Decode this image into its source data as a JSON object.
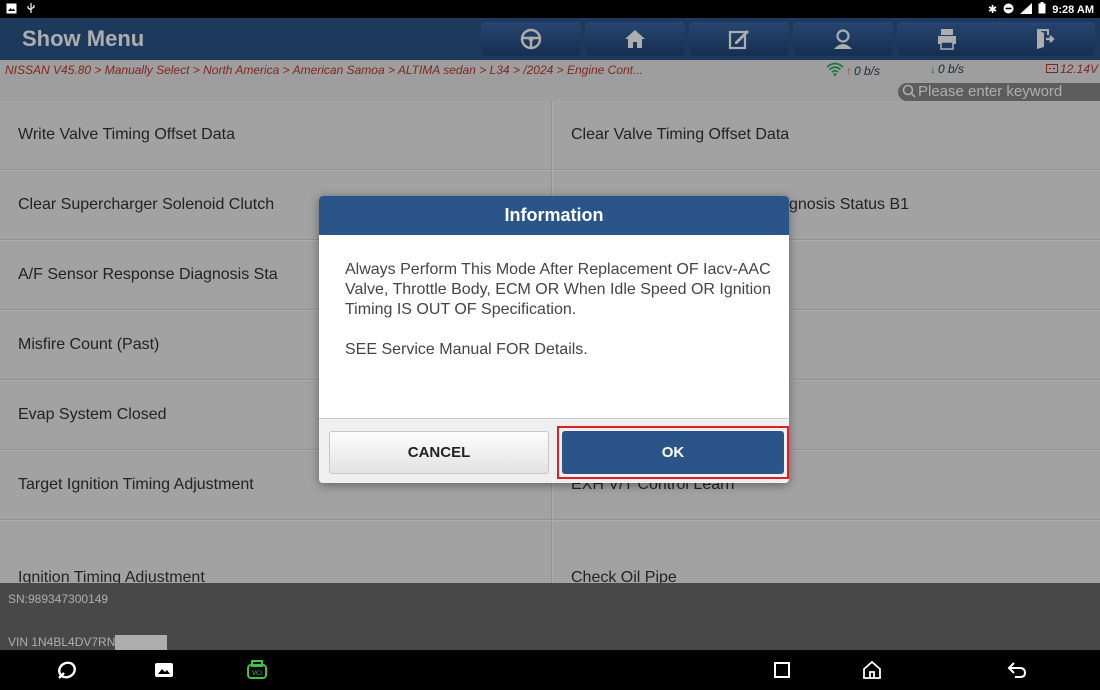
{
  "status_bar": {
    "time": "9:28 AM",
    "icons": [
      "image-icon",
      "usb-icon",
      "bluetooth-icon",
      "dnd-icon",
      "signal-icon",
      "battery-icon"
    ]
  },
  "header": {
    "title": "Show Menu",
    "buttons": [
      "steering-wheel-icon",
      "home-icon",
      "edit-report-icon",
      "user-icon",
      "print-icon",
      "exit-icon"
    ]
  },
  "breadcrumb": {
    "path": "NISSAN V45.80 > Manually Select > North America > American Samoa > ALTIMA sedan > L34 > /2024 > Engine Cont...",
    "upload_rate": "0 b/s",
    "download_rate": "0 b/s",
    "voltage": "12.14V"
  },
  "search": {
    "placeholder": "Please enter keyword"
  },
  "menu": {
    "left": [
      "Write Valve Timing Offset Data",
      "Clear Supercharger Solenoid Clutch",
      "A/F Sensor Response Diagnosis Sta",
      "Misfire Count (Past)",
      "Evap System Closed",
      "Target Ignition Timing Adjustment",
      "Ignition Timing Adjustment"
    ],
    "right": [
      "Clear Valve Timing Offset Data",
      "gnosis Status B1",
      "",
      "",
      "",
      "EXH V/T Control Learn",
      "Check Oil Pipe"
    ]
  },
  "footer": {
    "sn": "SN:989347300149",
    "vin": "VIN 1N4BL4DV7RN"
  },
  "dialog": {
    "title": "Information",
    "message_1": "Always Perform This Mode After Replacement OF Iacv-AAC Valve, Throttle Body, ECM OR When Idle Speed OR Ignition Timing IS OUT OF Specification.",
    "message_2": "SEE Service Manual FOR Details.",
    "cancel_label": "CANCEL",
    "ok_label": "OK"
  },
  "colors": {
    "header_blue": "#2b5488",
    "highlight_red": "#e02020",
    "crumb_red": "#c0392b"
  }
}
